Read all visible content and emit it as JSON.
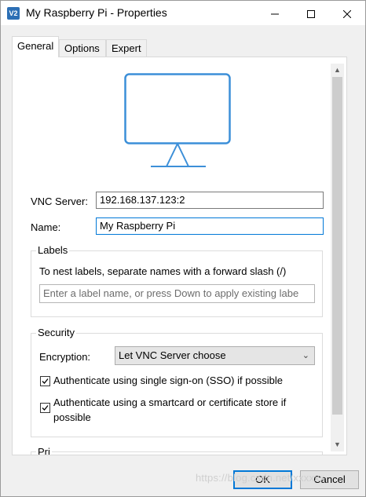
{
  "window": {
    "title": "My Raspberry Pi - Properties",
    "app_icon_text": "V2"
  },
  "tabs": [
    {
      "label": "General",
      "active": true
    },
    {
      "label": "Options",
      "active": false
    },
    {
      "label": "Expert",
      "active": false
    }
  ],
  "general": {
    "vnc_server_label": "VNC Server:",
    "vnc_server_value": "192.168.137.123:2",
    "name_label": "Name:",
    "name_value": "My Raspberry Pi",
    "labels_group": {
      "title": "Labels",
      "hint": "To nest labels, separate names with a forward slash (/)",
      "input_placeholder": "Enter a label name, or press Down to apply existing labe"
    },
    "security_group": {
      "title": "Security",
      "encryption_label": "Encryption:",
      "encryption_value": "Let VNC Server choose",
      "sso_label": "Authenticate using single sign-on (SSO) if possible",
      "sso_checked": true,
      "smartcard_label_line1": "Authenticate using a smartcard or certificate store if",
      "smartcard_label_line2": "possible",
      "smartcard_checked": true
    },
    "next_group_partial": "Pri"
  },
  "buttons": {
    "ok": "OK",
    "cancel": "Cancel"
  },
  "watermark": "https://blog.csdn.net/xxxxxx",
  "colors": {
    "accent": "#0078d7",
    "monitor_icon": "#3c8fd8"
  }
}
